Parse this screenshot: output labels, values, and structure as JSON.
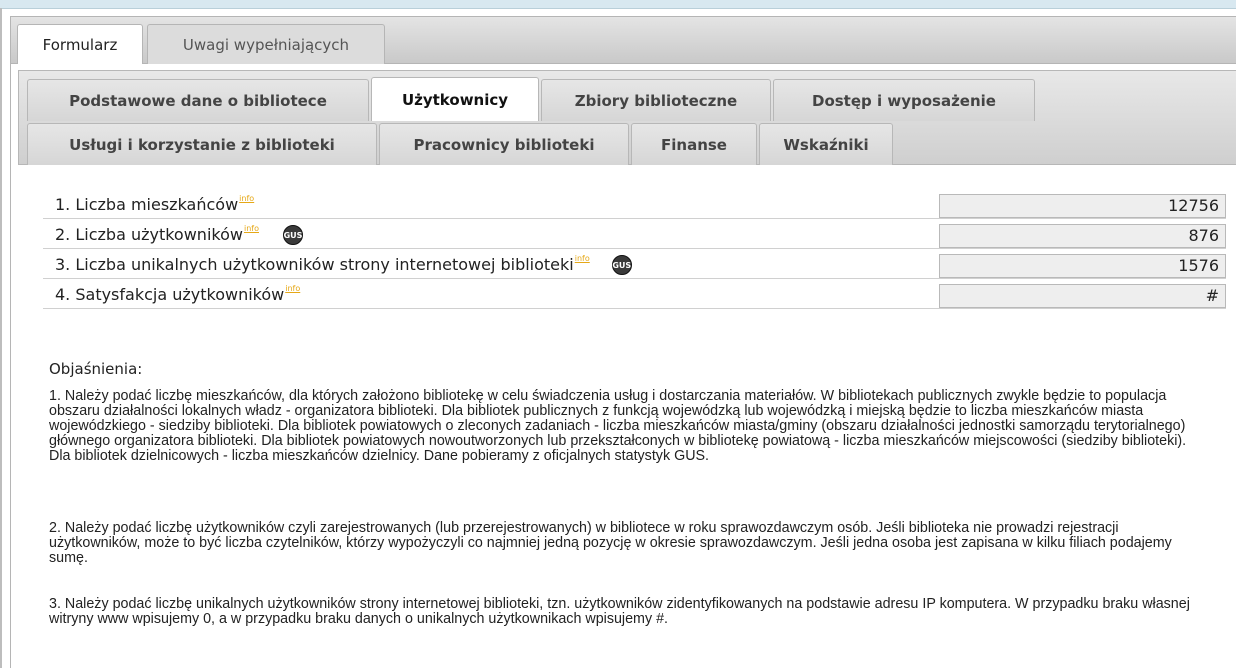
{
  "outer_tabs": [
    "Formularz",
    "Uwagi wypełniających"
  ],
  "inner_tabs_row1": [
    "Podstawowe dane o bibliotece",
    "Użytkownicy",
    "Zbiory biblioteczne",
    "Dostęp i wyposażenie"
  ],
  "inner_tabs_row2": [
    "Usługi i korzystanie z biblioteki",
    "Pracownicy biblioteki",
    "Finanse",
    "Wskaźniki"
  ],
  "info_label": "info",
  "gus_label": "GUS",
  "fields": [
    {
      "label": "1. Liczba mieszkańców",
      "value": "12756"
    },
    {
      "label": "2. Liczba użytkowników",
      "value": "876"
    },
    {
      "label": "3. Liczba unikalnych użytkowników strony internetowej biblioteki",
      "value": "1576"
    },
    {
      "label": "4. Satysfakcja użytkowników",
      "value": "#"
    }
  ],
  "explanations_title": "Objaśnienia:",
  "explanations": [
    "1. Należy podać liczbę mieszkańców, dla których założono bibliotekę w celu świadczenia usług i dostarczania materiałów. W bibliotekach publicznych zwykle będzie to populacja obszaru działalności lokalnych władz - organizatora biblioteki. Dla bibliotek publicznych z funkcją wojewódzką lub wojewódzką i miejską będzie to liczba mieszkańców miasta wojewódzkiego - siedziby biblioteki. Dla bibliotek powiatowych o zleconych zadaniach - liczba mieszkańców miasta/gminy (obszaru działalności jednostki samorządu terytorialnego) głównego organizatora biblioteki. Dla bibliotek powiatowych nowoutworzonych lub przekształconych w bibliotekę powiatową - liczba mieszkańców miejscowości (siedziby biblioteki). Dla bibliotek dzielnicowych - liczba mieszkańców dzielnicy. Dane pobieramy z oficjalnych statystyk GUS.",
    "2. Należy podać liczbę użytkowników czyli zarejestrowanych (lub przerejestrowanych) w bibliotece w roku sprawozdawczym osób. Jeśli biblioteka nie prowadzi rejestracji użytkowników, może to być liczba czytelników, którzy wypożyczyli co najmniej jedną pozycję w okresie sprawozdawczym. Jeśli jedna osoba jest zapisana w kilku filiach podajemy sumę.",
    "3. Należy podać liczbę unikalnych użytkowników strony internetowej biblioteki, tzn. użytkowników zidentyfikowanych na podstawie adresu IP komputera. W przypadku braku własnej witryny www wpisujemy 0, a w przypadku braku danych o unikalnych użytkownikach wpisujemy #."
  ]
}
